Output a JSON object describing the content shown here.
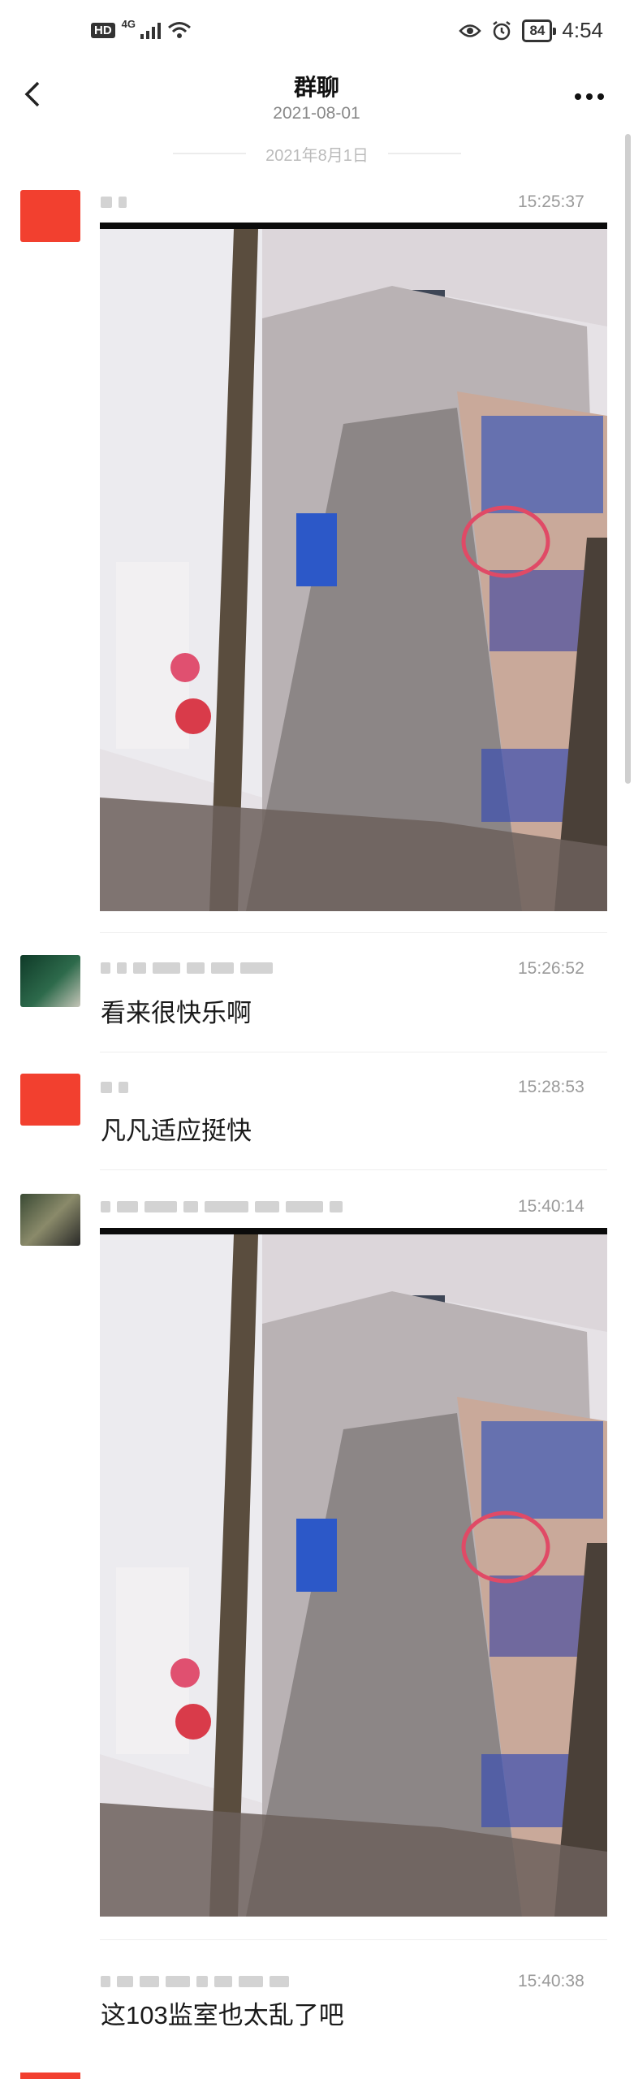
{
  "status_bar": {
    "hd": "HD",
    "network": "4G",
    "battery": "84",
    "time": "4:54",
    "icons": [
      "signal-icon",
      "wifi-icon",
      "eye-icon",
      "alarm-icon",
      "battery-icon"
    ]
  },
  "header": {
    "title": "群聊",
    "subtitle": "2021-08-01",
    "back_icon": "chevron-left-icon",
    "more_icon": "more-icon"
  },
  "date_separator": "2021年8月1日",
  "messages": [
    {
      "time": "15:25:37",
      "type": "image"
    },
    {
      "time": "15:26:52",
      "type": "text",
      "text": "看来很快乐啊"
    },
    {
      "time": "15:28:53",
      "type": "text",
      "text": "凡凡适应挺快"
    },
    {
      "time": "15:40:14",
      "type": "image"
    },
    {
      "time": "15:40:38",
      "type": "text",
      "text": "这103监室也太乱了吧"
    }
  ],
  "colors": {
    "accent_red": "#f23a2a",
    "separator": "#eeeeee",
    "time_gray": "#9a9a9a"
  }
}
